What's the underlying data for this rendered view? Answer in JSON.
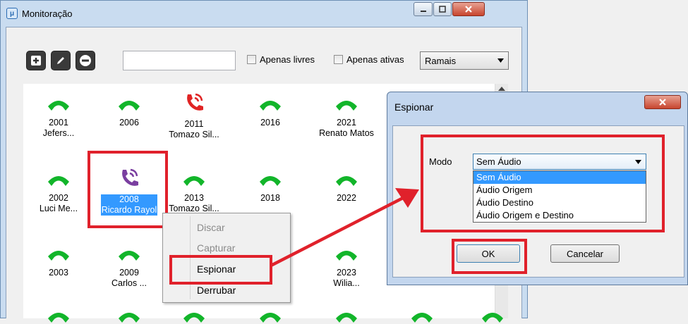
{
  "main_window": {
    "title": "Monitoração",
    "controls": {
      "minimize": "minimize",
      "maximize": "maximize",
      "close": "close"
    }
  },
  "toolbar": {
    "add_icon": "plus-icon",
    "edit_icon": "pencil-icon",
    "remove_icon": "minus-icon",
    "search_value": "",
    "only_free_label": "Apenas livres",
    "only_active_label": "Apenas ativas",
    "filter_selected": "Ramais"
  },
  "extensions": [
    {
      "number": "2001",
      "name": "Jefers...",
      "status": "idle"
    },
    {
      "number": "2006",
      "name": "",
      "status": "idle"
    },
    {
      "number": "2011",
      "name": "Tomazo Sil...",
      "status": "in-call"
    },
    {
      "number": "2016",
      "name": "",
      "status": "idle"
    },
    {
      "number": "2021",
      "name": "Renato Matos",
      "status": "idle"
    },
    {
      "number": "2002",
      "name": "Luci Me...",
      "status": "idle"
    },
    {
      "number": "2008",
      "name": "Ricardo Rayol",
      "status": "monitored"
    },
    {
      "number": "2013",
      "name": "Tomazo Sil...",
      "status": "idle"
    },
    {
      "number": "2018",
      "name": "",
      "status": "idle"
    },
    {
      "number": "2022",
      "name": "",
      "status": "idle"
    },
    {
      "number": "2003",
      "name": "",
      "status": "idle"
    },
    {
      "number": "2009",
      "name": "Carlos ...",
      "status": "idle"
    },
    {
      "number": "2023",
      "name": "Wilia...",
      "status": "idle"
    }
  ],
  "context_menu": {
    "items": [
      "Discar",
      "Capturar",
      "Espionar",
      "Derrubar"
    ],
    "disabled": [
      "Discar",
      "Capturar"
    ],
    "highlighted": "Espionar"
  },
  "dialog": {
    "title": "Espionar",
    "mode_label": "Modo",
    "mode_selected": "Sem Áudio",
    "options": [
      "Sem Áudio",
      "Áudio Origem",
      "Áudio Destino",
      "Áudio Origem e Destino"
    ],
    "ok_label": "OK",
    "cancel_label": "Cancelar"
  },
  "colors": {
    "idle_phone": "#12b52a",
    "in_call_phone": "#e02424",
    "monitored_phone": "#7a3fa0",
    "highlight": "#e0212b",
    "selection": "#3399ff"
  }
}
